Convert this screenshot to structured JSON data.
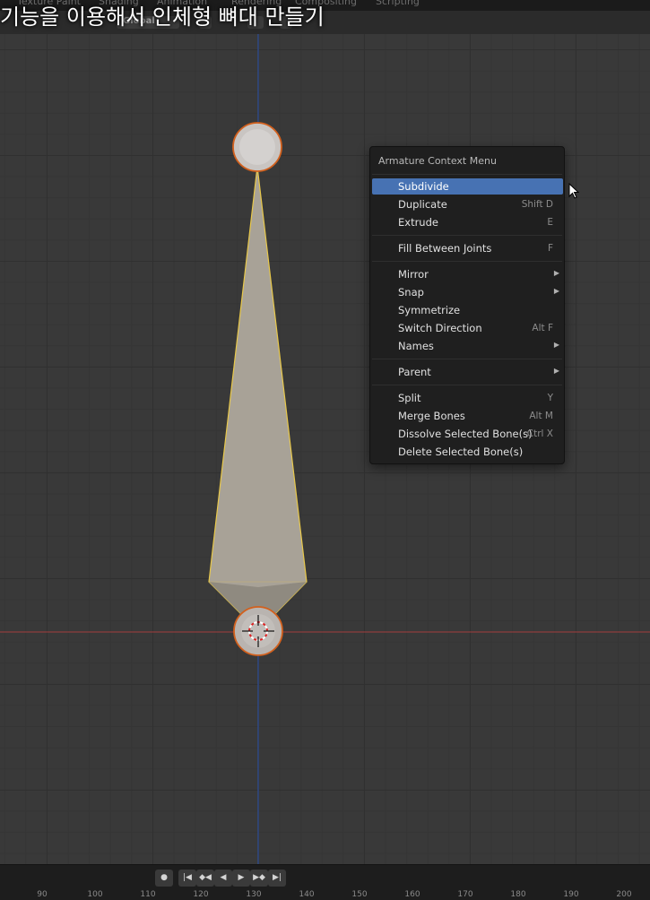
{
  "subtitle": "기능을 이용해서 인체형 뼈대 만들기",
  "workspace_tabs": [
    "Texture Paint",
    "Shading",
    "Animation",
    "Rendering",
    "Compositing",
    "Scripting"
  ],
  "header": {
    "orientation": "Global"
  },
  "context_menu": {
    "title": "Armature Context Menu",
    "groups": [
      [
        {
          "label": "Subdivide",
          "shortcut": "",
          "submenu": false,
          "active": true
        },
        {
          "label": "Duplicate",
          "shortcut": "Shift D",
          "submenu": false
        },
        {
          "label": "Extrude",
          "shortcut": "E",
          "submenu": false
        }
      ],
      [
        {
          "label": "Fill Between Joints",
          "shortcut": "F",
          "submenu": false
        }
      ],
      [
        {
          "label": "Mirror",
          "shortcut": "",
          "submenu": true
        },
        {
          "label": "Snap",
          "shortcut": "",
          "submenu": true
        },
        {
          "label": "Symmetrize",
          "shortcut": "",
          "submenu": false
        },
        {
          "label": "Switch Direction",
          "shortcut": "Alt F",
          "submenu": false
        },
        {
          "label": "Names",
          "shortcut": "",
          "submenu": true
        }
      ],
      [
        {
          "label": "Parent",
          "shortcut": "",
          "submenu": true
        }
      ],
      [
        {
          "label": "Split",
          "shortcut": "Y",
          "submenu": false
        },
        {
          "label": "Merge Bones",
          "shortcut": "Alt M",
          "submenu": false
        },
        {
          "label": "Dissolve Selected Bone(s)",
          "shortcut": "Ctrl X",
          "submenu": false
        },
        {
          "label": "Delete Selected Bone(s)",
          "shortcut": "",
          "submenu": false
        }
      ]
    ]
  },
  "timeline": {
    "frame_numbers": [
      "90",
      "100",
      "110",
      "120",
      "130",
      "140",
      "150",
      "160",
      "170",
      "180",
      "190",
      "200"
    ]
  },
  "colors": {
    "menu_highlight": "#4772b3",
    "bone_fill": "#a8a297",
    "bone_outline": "#e8c84a",
    "joint_outline": "#d2601d",
    "axis_x": "#a33d3d",
    "axis_y": "#2f4f99"
  }
}
